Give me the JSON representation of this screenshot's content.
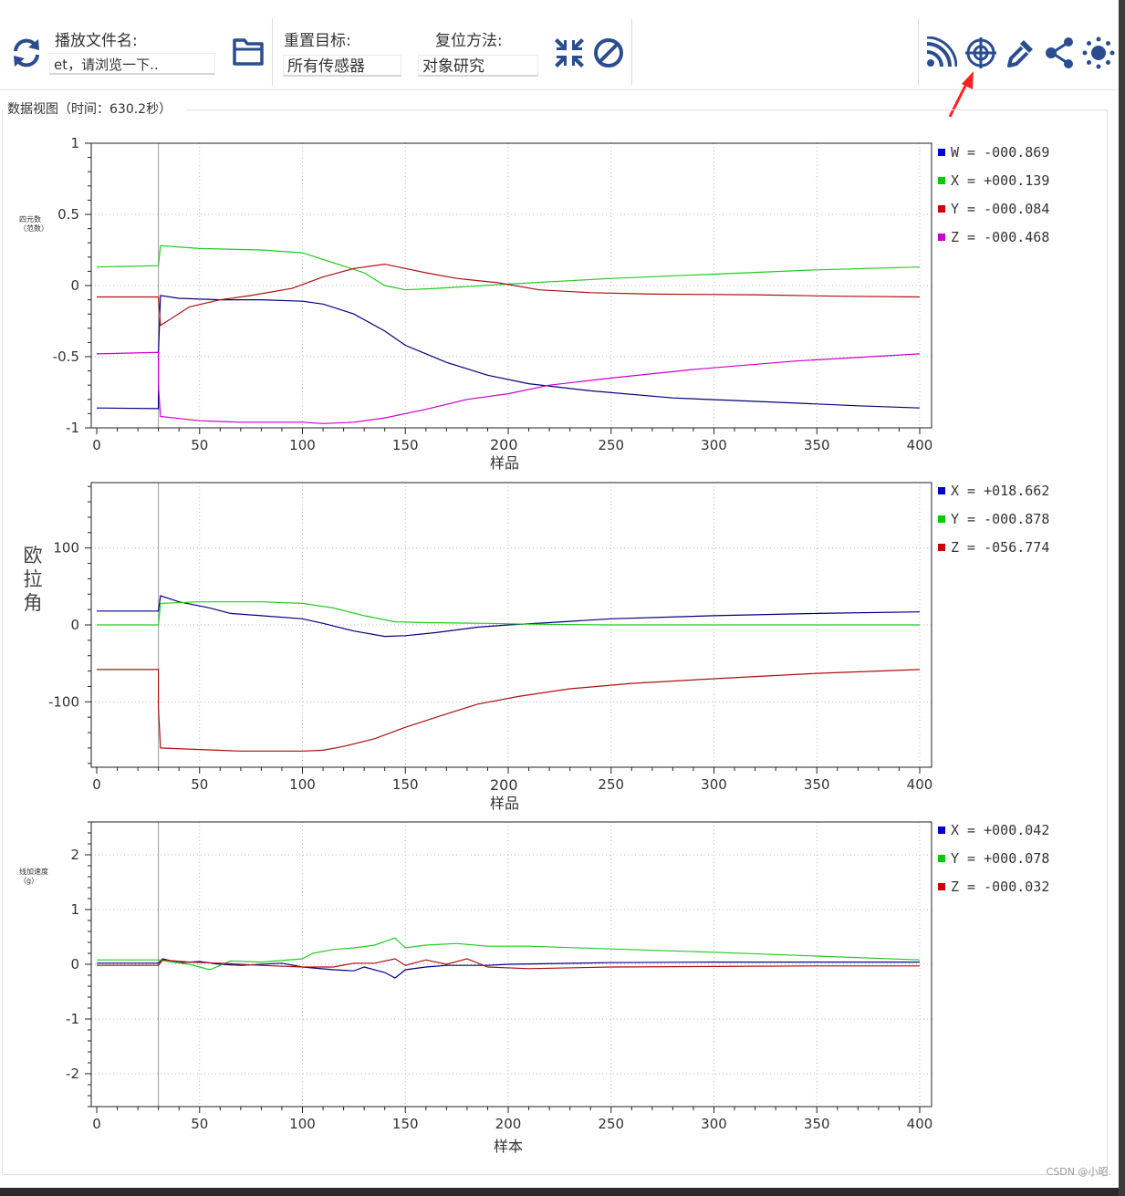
{
  "toolbar": {
    "play_file_label": "播放文件名:",
    "play_file_value": "et，请浏览一下..",
    "reset_target_label": "重置目标:",
    "reset_target_value": "所有传感器",
    "reset_method_label": "复位方法:",
    "reset_method_value": "对象研究",
    "icons": [
      "refresh-icon",
      "folder-icon",
      "compress-icon",
      "ban-icon",
      "rss-icon",
      "target-icon",
      "eyedropper-icon",
      "share-icon",
      "brightness-icon"
    ]
  },
  "view": {
    "title": "数据视图（时间：630.2秒）"
  },
  "accent_colors": {
    "W": "#00008b",
    "X": "#00cc00",
    "Y": "#cc0000",
    "Z": "#cc00cc",
    "icon": "#2b4d8f",
    "annotation_arrow": "#ff2020"
  },
  "watermark": "CSDN @小昭.",
  "plots": [
    {
      "id": "quaternion",
      "ylabel": "四元数（范数）",
      "xlabel": "200样品",
      "legend": [
        {
          "name": "W",
          "value": "-000.869",
          "color": "#0000cc"
        },
        {
          "name": "X",
          "value": "+000.139",
          "color": "#00cc00"
        },
        {
          "name": "Y",
          "value": "-000.084",
          "color": "#cc0000"
        },
        {
          "name": "Z",
          "value": "-000.468",
          "color": "#cc00cc"
        }
      ]
    },
    {
      "id": "euler",
      "ylabel": "欧拉角",
      "xlabel": "200样品",
      "legend": [
        {
          "name": "X",
          "value": "+018.662",
          "color": "#0000cc"
        },
        {
          "name": "Y",
          "value": "-000.878",
          "color": "#00cc00"
        },
        {
          "name": "Z",
          "value": "-056.774",
          "color": "#cc0000"
        }
      ]
    },
    {
      "id": "accel",
      "ylabel": "线加速度（g）",
      "xlabel": "样本",
      "legend": [
        {
          "name": "X",
          "value": "+000.042",
          "color": "#0000cc"
        },
        {
          "name": "Y",
          "value": "+000.078",
          "color": "#00cc00"
        },
        {
          "name": "Z",
          "value": "-000.032",
          "color": "#cc0000"
        }
      ]
    }
  ],
  "chart_data": [
    {
      "type": "line",
      "ylabel": "四元数（范数）",
      "xlabel": "200样品",
      "xlim": [
        0,
        400
      ],
      "ylim": [
        -1,
        1
      ],
      "xticks": [
        0,
        50,
        100,
        150,
        200,
        250,
        300,
        350,
        400
      ],
      "xtick_labels": [
        "0",
        "50",
        "100",
        "150",
        "",
        "250",
        "300",
        "350",
        "400"
      ],
      "yticks": [
        -1,
        -0.5,
        0,
        0.5,
        1
      ],
      "ytick_labels": [
        "-1",
        "-0.5",
        "0",
        "0.5",
        "1"
      ],
      "cursor_x": 30,
      "grid": true,
      "legend_position": "right",
      "series": [
        {
          "name": "W",
          "color": "#000080",
          "points": [
            [
              0,
              -0.86
            ],
            [
              30,
              -0.865
            ],
            [
              30,
              -0.48
            ],
            [
              31,
              -0.07
            ],
            [
              40,
              -0.09
            ],
            [
              60,
              -0.1
            ],
            [
              80,
              -0.1
            ],
            [
              100,
              -0.11
            ],
            [
              110,
              -0.13
            ],
            [
              125,
              -0.2
            ],
            [
              140,
              -0.32
            ],
            [
              150,
              -0.42
            ],
            [
              170,
              -0.54
            ],
            [
              190,
              -0.63
            ],
            [
              210,
              -0.69
            ],
            [
              240,
              -0.74
            ],
            [
              280,
              -0.79
            ],
            [
              330,
              -0.82
            ],
            [
              370,
              -0.845
            ],
            [
              400,
              -0.86
            ]
          ]
        },
        {
          "name": "X",
          "color": "#22cc22",
          "points": [
            [
              0,
              0.13
            ],
            [
              30,
              0.14
            ],
            [
              31,
              0.28
            ],
            [
              50,
              0.26
            ],
            [
              80,
              0.25
            ],
            [
              100,
              0.23
            ],
            [
              115,
              0.16
            ],
            [
              130,
              0.09
            ],
            [
              140,
              0.0
            ],
            [
              150,
              -0.03
            ],
            [
              165,
              -0.02
            ],
            [
              200,
              0.01
            ],
            [
              250,
              0.05
            ],
            [
              300,
              0.08
            ],
            [
              350,
              0.11
            ],
            [
              400,
              0.13
            ]
          ]
        },
        {
          "name": "Y",
          "color": "#aa1111",
          "points": [
            [
              0,
              -0.08
            ],
            [
              30,
              -0.08
            ],
            [
              31,
              -0.28
            ],
            [
              45,
              -0.15
            ],
            [
              60,
              -0.1
            ],
            [
              75,
              -0.07
            ],
            [
              95,
              -0.02
            ],
            [
              110,
              0.06
            ],
            [
              125,
              0.12
            ],
            [
              140,
              0.15
            ],
            [
              150,
              0.12
            ],
            [
              160,
              0.09
            ],
            [
              175,
              0.05
            ],
            [
              195,
              0.02
            ],
            [
              215,
              -0.03
            ],
            [
              240,
              -0.05
            ],
            [
              270,
              -0.06
            ],
            [
              320,
              -0.065
            ],
            [
              360,
              -0.075
            ],
            [
              400,
              -0.08
            ]
          ]
        },
        {
          "name": "Z",
          "color": "#cc00cc",
          "points": [
            [
              0,
              -0.48
            ],
            [
              30,
              -0.47
            ],
            [
              30,
              -0.7
            ],
            [
              31,
              -0.92
            ],
            [
              50,
              -0.95
            ],
            [
              70,
              -0.96
            ],
            [
              100,
              -0.96
            ],
            [
              110,
              -0.97
            ],
            [
              125,
              -0.96
            ],
            [
              140,
              -0.93
            ],
            [
              160,
              -0.87
            ],
            [
              180,
              -0.8
            ],
            [
              200,
              -0.76
            ],
            [
              220,
              -0.7
            ],
            [
              250,
              -0.65
            ],
            [
              290,
              -0.59
            ],
            [
              340,
              -0.53
            ],
            [
              400,
              -0.48
            ]
          ]
        }
      ]
    },
    {
      "type": "line",
      "ylabel": "欧拉角",
      "xlabel": "200样品",
      "xlim": [
        0,
        400
      ],
      "ylim": [
        -185,
        185
      ],
      "xticks": [
        0,
        50,
        100,
        150,
        200,
        250,
        300,
        350,
        400
      ],
      "xtick_labels": [
        "0",
        "50",
        "100",
        "150",
        "",
        "250",
        "300",
        "350",
        "400"
      ],
      "yticks": [
        -100,
        0,
        100
      ],
      "ytick_labels": [
        "-100",
        "0",
        "100"
      ],
      "cursor_x": 30,
      "grid": true,
      "legend_position": "right",
      "series": [
        {
          "name": "X",
          "color": "#000080",
          "points": [
            [
              0,
              18
            ],
            [
              30,
              18
            ],
            [
              31,
              38
            ],
            [
              40,
              30
            ],
            [
              55,
              22
            ],
            [
              65,
              15
            ],
            [
              80,
              12
            ],
            [
              100,
              8
            ],
            [
              110,
              2
            ],
            [
              125,
              -8
            ],
            [
              140,
              -15
            ],
            [
              150,
              -14
            ],
            [
              165,
              -10
            ],
            [
              185,
              -3
            ],
            [
              200,
              0
            ],
            [
              220,
              3
            ],
            [
              250,
              8
            ],
            [
              300,
              12
            ],
            [
              350,
              15
            ],
            [
              400,
              17
            ]
          ]
        },
        {
          "name": "Y",
          "color": "#22cc22",
          "points": [
            [
              0,
              0
            ],
            [
              30,
              0
            ],
            [
              31,
              28
            ],
            [
              50,
              30
            ],
            [
              80,
              30
            ],
            [
              100,
              28
            ],
            [
              115,
              22
            ],
            [
              130,
              12
            ],
            [
              145,
              4
            ],
            [
              160,
              3
            ],
            [
              190,
              2
            ],
            [
              210,
              1
            ],
            [
              250,
              0
            ],
            [
              300,
              0
            ],
            [
              400,
              0
            ]
          ]
        },
        {
          "name": "Z",
          "color": "#aa1111",
          "points": [
            [
              0,
              -58
            ],
            [
              30,
              -58
            ],
            [
              30,
              -108
            ],
            [
              31,
              -160
            ],
            [
              50,
              -162
            ],
            [
              70,
              -164
            ],
            [
              100,
              -164
            ],
            [
              110,
              -163
            ],
            [
              120,
              -158
            ],
            [
              135,
              -148
            ],
            [
              150,
              -133
            ],
            [
              165,
              -120
            ],
            [
              185,
              -103
            ],
            [
              205,
              -93
            ],
            [
              230,
              -83
            ],
            [
              260,
              -76
            ],
            [
              300,
              -70
            ],
            [
              350,
              -63
            ],
            [
              400,
              -58
            ]
          ]
        }
      ]
    },
    {
      "type": "line",
      "ylabel": "线加速度（g）",
      "xlabel": "样本",
      "xlim": [
        0,
        400
      ],
      "ylim": [
        -2.6,
        2.6
      ],
      "xticks": [
        0,
        50,
        100,
        150,
        200,
        250,
        300,
        350,
        400
      ],
      "xtick_labels": [
        "0",
        "50",
        "100",
        "150",
        "200",
        "250",
        "300",
        "350",
        "400"
      ],
      "yticks": [
        -2,
        -1,
        0,
        1,
        2
      ],
      "ytick_labels": [
        "-2",
        "-1",
        "0",
        "1",
        "2"
      ],
      "cursor_x": 30,
      "grid": true,
      "legend_position": "right",
      "series": [
        {
          "name": "X",
          "color": "#000080",
          "points": [
            [
              0,
              0.02
            ],
            [
              30,
              0.02
            ],
            [
              32,
              0.1
            ],
            [
              40,
              0.03
            ],
            [
              50,
              0.05
            ],
            [
              60,
              0.0
            ],
            [
              70,
              -0.02
            ],
            [
              90,
              0.02
            ],
            [
              100,
              -0.05
            ],
            [
              115,
              -0.1
            ],
            [
              125,
              -0.12
            ],
            [
              130,
              -0.05
            ],
            [
              140,
              -0.15
            ],
            [
              145,
              -0.25
            ],
            [
              150,
              -0.1
            ],
            [
              160,
              -0.05
            ],
            [
              170,
              -0.02
            ],
            [
              190,
              -0.02
            ],
            [
              200,
              0.0
            ],
            [
              250,
              0.03
            ],
            [
              300,
              0.04
            ],
            [
              350,
              0.04
            ],
            [
              400,
              0.04
            ]
          ]
        },
        {
          "name": "Y",
          "color": "#22cc22",
          "points": [
            [
              0,
              0.08
            ],
            [
              30,
              0.08
            ],
            [
              35,
              0.05
            ],
            [
              45,
              0.0
            ],
            [
              55,
              -0.1
            ],
            [
              65,
              0.06
            ],
            [
              80,
              0.04
            ],
            [
              100,
              0.1
            ],
            [
              105,
              0.2
            ],
            [
              115,
              0.27
            ],
            [
              125,
              0.3
            ],
            [
              135,
              0.35
            ],
            [
              145,
              0.48
            ],
            [
              150,
              0.3
            ],
            [
              160,
              0.35
            ],
            [
              175,
              0.38
            ],
            [
              190,
              0.33
            ],
            [
              210,
              0.33
            ],
            [
              250,
              0.28
            ],
            [
              300,
              0.22
            ],
            [
              350,
              0.15
            ],
            [
              400,
              0.08
            ]
          ]
        },
        {
          "name": "Z",
          "color": "#aa1111",
          "points": [
            [
              0,
              -0.02
            ],
            [
              30,
              -0.02
            ],
            [
              32,
              0.08
            ],
            [
              45,
              0.04
            ],
            [
              60,
              0.02
            ],
            [
              80,
              -0.02
            ],
            [
              100,
              -0.05
            ],
            [
              115,
              -0.05
            ],
            [
              125,
              0.02
            ],
            [
              135,
              0.02
            ],
            [
              145,
              0.1
            ],
            [
              150,
              -0.02
            ],
            [
              160,
              0.08
            ],
            [
              170,
              0.0
            ],
            [
              180,
              0.1
            ],
            [
              190,
              -0.05
            ],
            [
              210,
              -0.08
            ],
            [
              250,
              -0.05
            ],
            [
              300,
              -0.04
            ],
            [
              350,
              -0.03
            ],
            [
              400,
              -0.03
            ]
          ]
        }
      ]
    }
  ]
}
